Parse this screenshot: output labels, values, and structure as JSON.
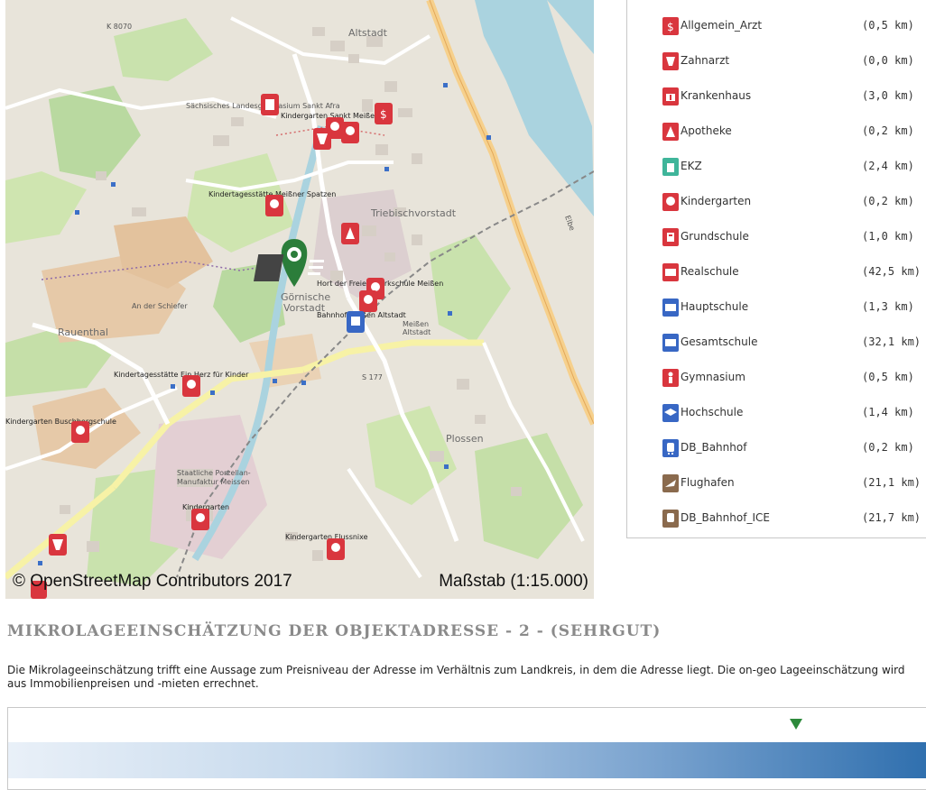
{
  "map": {
    "credit": "© OpenStreetMap Contributors 2017",
    "scale": "Maßstab (1:15.000)",
    "districts": [
      "Altstadt",
      "Triebischvorstadt",
      "Rauenthal",
      "Plossen",
      "Görnische Vorstadt",
      "Meißen Altstadt"
    ],
    "labels": {
      "museum": "Sächsisches Landesgymnasium Sankt Afra",
      "kita1": "Kindergarten Sankt Meißen",
      "kita2": "Kindertagesstätte Meißner Spatzen",
      "school": "Hort der Freien Werkschule Meißen",
      "station": "Bahnhof Meißen Altstadt",
      "kita3": "Kindertagesstätte Ein Herz für Kinder",
      "kita4": "Kindergarten Buschbergschule",
      "kita5": "Kindergarten",
      "kita6": "Kindergarten Flussnixe",
      "museum2": "Staatliche Porzellan-Manufaktur Meissen",
      "road1": "S 177",
      "road2": "K 8070",
      "road3": "An der Schiefer",
      "river": "Elbe"
    }
  },
  "poi_list": [
    {
      "name": "Allgemein_Arzt",
      "distance": "(0,5 km)",
      "icon": "doctor-icon",
      "color": "#d9363e"
    },
    {
      "name": "Zahnarzt",
      "distance": "(0,0 km)",
      "icon": "tooth-icon",
      "color": "#d9363e"
    },
    {
      "name": "Krankenhaus",
      "distance": "(3,0 km)",
      "icon": "hospital-icon",
      "color": "#d9363e"
    },
    {
      "name": "Apotheke",
      "distance": "(0,2 km)",
      "icon": "pharmacy-icon",
      "color": "#d9363e"
    },
    {
      "name": "EKZ",
      "distance": "(2,4 km)",
      "icon": "shopping-icon",
      "color": "#3fb59a"
    },
    {
      "name": "Kindergarten",
      "distance": "(0,2 km)",
      "icon": "kindergarten-icon",
      "color": "#d9363e"
    },
    {
      "name": "Grundschule",
      "distance": "(1,0 km)",
      "icon": "primary-school-icon",
      "color": "#d9363e"
    },
    {
      "name": "Realschule",
      "distance": "(42,5 km)",
      "icon": "secondary-school-icon",
      "color": "#d9363e"
    },
    {
      "name": "Hauptschule",
      "distance": "(1,3 km)",
      "icon": "school-blue-icon",
      "color": "#3867c4"
    },
    {
      "name": "Gesamtschule",
      "distance": "(32,1 km)",
      "icon": "comprehensive-school-icon",
      "color": "#3867c4"
    },
    {
      "name": "Gymnasium",
      "distance": "(0,5 km)",
      "icon": "gymnasium-icon",
      "color": "#d9363e"
    },
    {
      "name": "Hochschule",
      "distance": "(1,4 km)",
      "icon": "university-icon",
      "color": "#3867c4"
    },
    {
      "name": "DB_Bahnhof",
      "distance": "(0,2 km)",
      "icon": "train-icon",
      "color": "#3867c4"
    },
    {
      "name": "Flughafen",
      "distance": "(21,1 km)",
      "icon": "airport-icon",
      "color": "#8a6a4d"
    },
    {
      "name": "DB_Bahnhof_ICE",
      "distance": "(21,7 km)",
      "icon": "ice-train-icon",
      "color": "#8a6a4d"
    }
  ],
  "micro": {
    "title": "MIKROLAGEEINSCHÄTZUNG DER OBJEKTADRESSE - 2 - (SEHRGUT)",
    "description": "Die Mikrolageeinschätzung trifft eine Aussage zum Preisniveau der Adresse im Verhältnis zum Landkreis, in dem die Adresse liegt. Die on-geo Lageeinschätzung wird aus Immobilienpreisen und -mieten errechnet.",
    "marker_color": "#2d8a3b"
  }
}
